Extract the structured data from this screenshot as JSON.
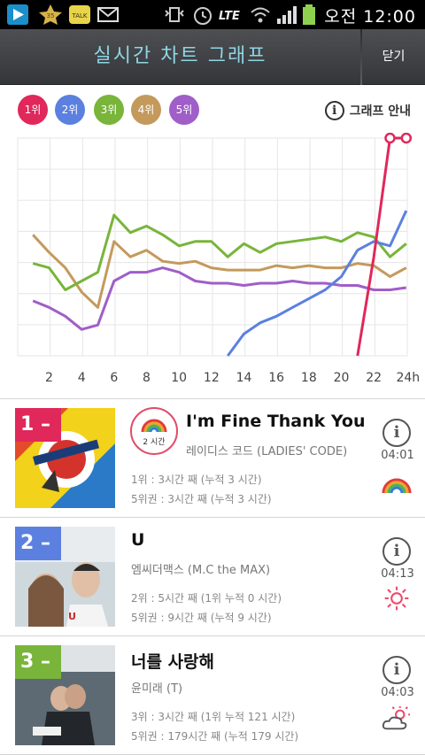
{
  "status_bar": {
    "time": "오전 12:00",
    "network": "LTE"
  },
  "header": {
    "title": "실시간 차트 그래프",
    "close_label": "닫기"
  },
  "rank_chips": [
    {
      "label": "1위",
      "color": "#e0285a"
    },
    {
      "label": "2위",
      "color": "#5b80e0"
    },
    {
      "label": "3위",
      "color": "#78b53a"
    },
    {
      "label": "4위",
      "color": "#c49a5c"
    },
    {
      "label": "5위",
      "color": "#a05ec8"
    }
  ],
  "graph_guide_label": "그래프 안내",
  "chart_data": {
    "type": "line",
    "x": [
      1,
      2,
      3,
      4,
      5,
      6,
      7,
      8,
      9,
      10,
      11,
      12,
      13,
      14,
      15,
      16,
      17,
      18,
      19,
      20,
      21,
      22,
      23,
      24
    ],
    "x_tick_labels": [
      "2",
      "4",
      "6",
      "8",
      "10",
      "12",
      "14",
      "16",
      "18",
      "20",
      "22",
      "24h"
    ],
    "y_axis_inverted": true,
    "ylim": [
      1,
      100
    ],
    "grid": true,
    "series": [
      {
        "name": "1위",
        "color": "#e0285a",
        "values": [
          null,
          null,
          null,
          null,
          null,
          null,
          null,
          null,
          null,
          null,
          null,
          null,
          null,
          null,
          null,
          null,
          null,
          null,
          null,
          null,
          100,
          55,
          1,
          1
        ]
      },
      {
        "name": "2위",
        "color": "#5b80e0",
        "values": [
          null,
          null,
          null,
          null,
          null,
          null,
          null,
          null,
          null,
          null,
          null,
          null,
          100,
          90,
          85,
          82,
          78,
          74,
          70,
          64,
          52,
          48,
          50,
          34
        ]
      },
      {
        "name": "3위",
        "color": "#78b53a",
        "values": [
          58,
          60,
          70,
          66,
          62,
          36,
          44,
          41,
          45,
          50,
          48,
          48,
          55,
          49,
          53,
          49,
          48,
          47,
          46,
          48,
          44,
          46,
          55,
          49
        ]
      },
      {
        "name": "4위",
        "color": "#c49a5c",
        "values": [
          45,
          53,
          60,
          71,
          78,
          48,
          55,
          52,
          57,
          58,
          57,
          60,
          61,
          61,
          61,
          59,
          60,
          59,
          60,
          60,
          58,
          59,
          64,
          60
        ]
      },
      {
        "name": "5위",
        "color": "#a05ec8",
        "values": [
          75,
          78,
          82,
          88,
          86,
          66,
          62,
          62,
          60,
          62,
          66,
          67,
          67,
          68,
          67,
          67,
          66,
          67,
          67,
          68,
          68,
          70,
          70,
          69
        ]
      }
    ]
  },
  "songs": [
    {
      "rank": "1",
      "rank_color": "#e0285a",
      "title": "I'm Fine Thank You",
      "artist": "레이디스 코드 (LADIES' CODE)",
      "line1": "1위 : 3시간 째 (누적 3 시간)",
      "line2": "5위권 : 3시간 째 (누적 3 시간)",
      "duration": "04:01",
      "weather_icon": "rainbow-icon",
      "has_rainbow_badge": true,
      "rainbow_badge_label": "2 시간"
    },
    {
      "rank": "2",
      "rank_color": "#5b80e0",
      "title": "U",
      "artist": "엠씨더맥스 (M.C the MAX)",
      "line1": "2위 : 5시간 째 (1위 누적 0 시간)",
      "line2": "5위권 : 9시간 째 (누적 9 시간)",
      "duration": "04:13",
      "weather_icon": "sun-icon",
      "has_rainbow_badge": false
    },
    {
      "rank": "3",
      "rank_color": "#78b53a",
      "title": "너를 사랑해",
      "artist": "윤미래 (T)",
      "line1": "3위 : 3시간 째 (1위 누적 121 시간)",
      "line2": "5위권 : 179시간 째 (누적 179 시간)",
      "duration": "04:03",
      "weather_icon": "sun-cloud-icon",
      "has_rainbow_badge": false
    }
  ]
}
